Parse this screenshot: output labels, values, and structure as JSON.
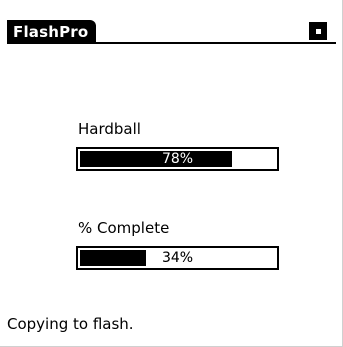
{
  "window": {
    "title": "FlashPro",
    "menu_icon": "menu-square-icon"
  },
  "progress": [
    {
      "label": "Hardball",
      "value_text": "78%",
      "fraction": 0.78
    },
    {
      "label": "% Complete",
      "value_text": "34%",
      "fraction": 0.34
    }
  ],
  "status": {
    "text": "Copying to flash."
  },
  "colors": {
    "foreground": "#000000",
    "background": "#ffffff"
  }
}
